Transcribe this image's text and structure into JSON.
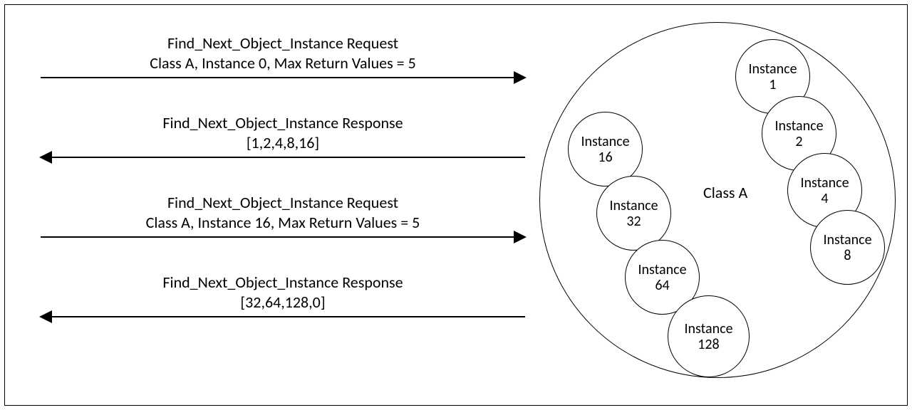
{
  "arrows": [
    {
      "line1": "Find_Next_Object_Instance Request",
      "line2": "Class A, Instance 0, Max Return Values = 5",
      "direction": "right"
    },
    {
      "line1": "Find_Next_Object_Instance Response",
      "line2": "[1,2,4,8,16]",
      "direction": "left"
    },
    {
      "line1": "Find_Next_Object_Instance Request",
      "line2": "Class A, Instance 16, Max Return Values = 5",
      "direction": "right"
    },
    {
      "line1": "Find_Next_Object_Instance Response",
      "line2": "[32,64,128,0]",
      "direction": "left"
    }
  ],
  "class_label": "Class A",
  "instances": {
    "i1": {
      "word": "Instance",
      "num": "1"
    },
    "i2": {
      "word": "Instance",
      "num": "2"
    },
    "i4": {
      "word": "Instance",
      "num": "4"
    },
    "i8": {
      "word": "Instance",
      "num": "8"
    },
    "i16": {
      "word": "Instance",
      "num": "16"
    },
    "i32": {
      "word": "Instance",
      "num": "32"
    },
    "i64": {
      "word": "Instance",
      "num": "64"
    },
    "i128": {
      "word": "Instance",
      "num": "128"
    }
  }
}
